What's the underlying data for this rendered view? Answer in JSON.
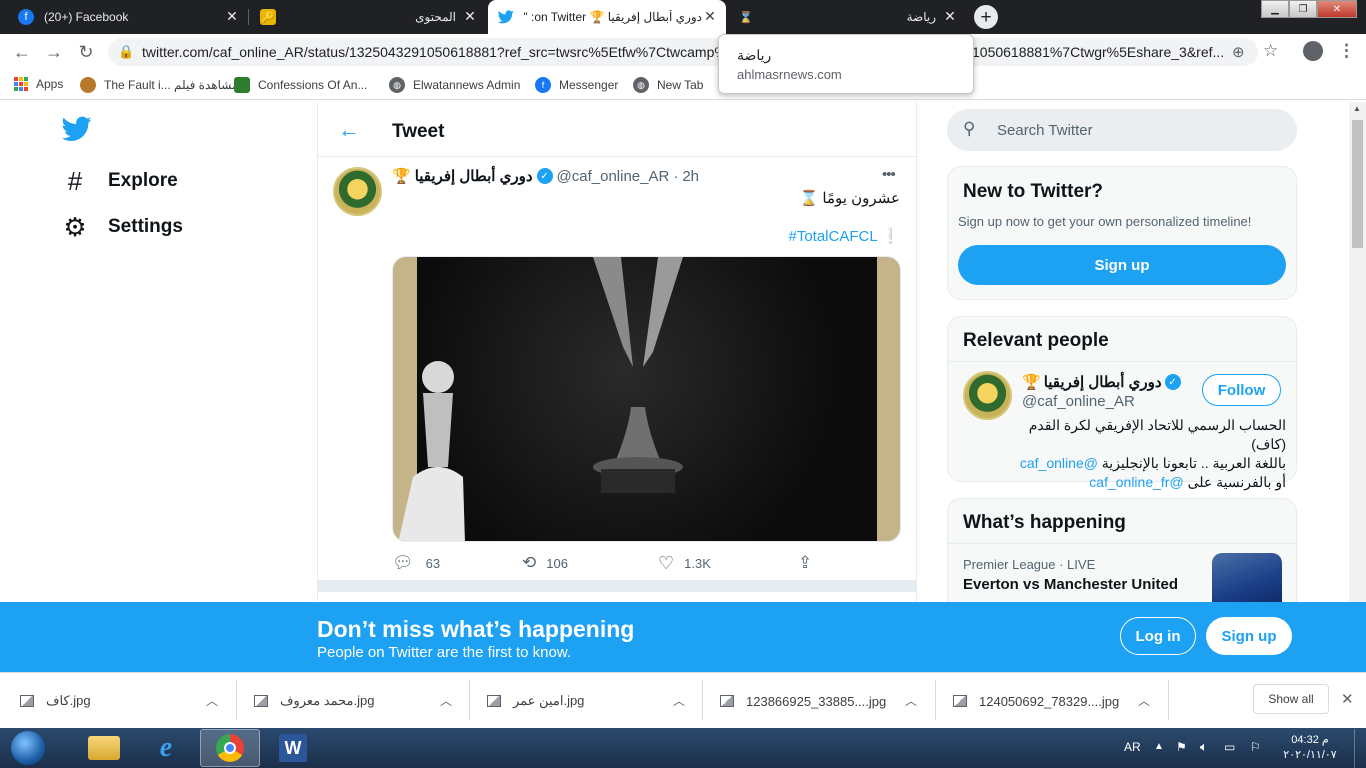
{
  "browser": {
    "tabs": [
      {
        "title": "(20+) Facebook",
        "icon": "facebook-icon"
      },
      {
        "title": "المحتوى",
        "icon": "key-icon"
      },
      {
        "title": "دوري أبطال إفريقيا 🏆 on Twitter: \"عشر",
        "icon": "twitter-icon"
      },
      {
        "title": "رياضة",
        "icon": "hourglass-icon"
      }
    ],
    "tab_tooltip": {
      "title": "رياضة",
      "domain": "ahlmasrnews.com"
    },
    "url": "twitter.com/caf_online_AR/status/1325043291050618881?ref_src=twsrc%5Etfw%7Ctwcamp%5",
    "url_tail": "1050618881%7Ctwgr%5Eshare_3&ref...",
    "bookmarks": [
      {
        "label": "Apps",
        "icon": "apps-grid-icon"
      },
      {
        "label": "The Fault i... مشاهدة فيلم",
        "icon": "tiger-icon"
      },
      {
        "label": "Confessions Of An...",
        "icon": "game-icon"
      },
      {
        "label": "Elwatannews Admin",
        "icon": "globe-icon"
      },
      {
        "label": "Messenger",
        "icon": "facebook-icon"
      },
      {
        "label": "New Tab",
        "icon": "globe-icon"
      }
    ]
  },
  "twitter": {
    "nav": [
      {
        "label": "Explore",
        "icon": "hashtag-icon"
      },
      {
        "label": "Settings",
        "icon": "gear-icon"
      }
    ],
    "header_title": "Tweet",
    "tweet": {
      "name": "دوري أبطال إفريقيا",
      "name_emoji": "🏆",
      "handle": "@caf_online_AR",
      "time": "2h",
      "text": "عشرون يومًا ⌛",
      "hashtag": "#TotalCAFCL",
      "hashtag_suffix": "❕",
      "replies": "63",
      "retweets": "106",
      "likes": "1.3K"
    },
    "search_placeholder": "Search Twitter",
    "new_to_twitter": {
      "title": "New to Twitter?",
      "subtitle": "Sign up now to get your own personalized timeline!",
      "button": "Sign up"
    },
    "relevant_people": {
      "title": "Relevant people",
      "name": "دوري أبطال إفريقيا",
      "name_emoji": "🏆",
      "handle": "@caf_online_AR",
      "follow": "Follow",
      "bio_line1": "الحساب الرسمي للاتحاد الإفريقي لكرة القدم (كاف)",
      "bio_line2_text": "باللغة العربية .. تابعونا بالإنجليزية",
      "bio_line2_link": "@caf_online",
      "bio_line3_text": "أو بالفرنسية على",
      "bio_line3_link": "@caf_online_fr"
    },
    "whats_happening": {
      "title": "What’s happening",
      "meta": "Premier League · LIVE",
      "headline": "Everton vs Manchester United"
    },
    "banner": {
      "title": "Don’t miss what’s happening",
      "subtitle": "People on Twitter are the first to know.",
      "login": "Log in",
      "signup": "Sign up"
    },
    "colors": {
      "accent": "#1da1f2",
      "text": "#0f1419",
      "muted": "#536471"
    }
  },
  "downloads": {
    "items": [
      "كاف.jpg",
      "محمد معروف.jpg",
      "امين عمر.jpg",
      "123866925_33885....jpg",
      "124050692_78329....jpg"
    ],
    "show_all": "Show all"
  },
  "taskbar": {
    "lang": "AR",
    "time": "04:32 م",
    "date": "٢٠٢٠/١١/٠٧"
  }
}
